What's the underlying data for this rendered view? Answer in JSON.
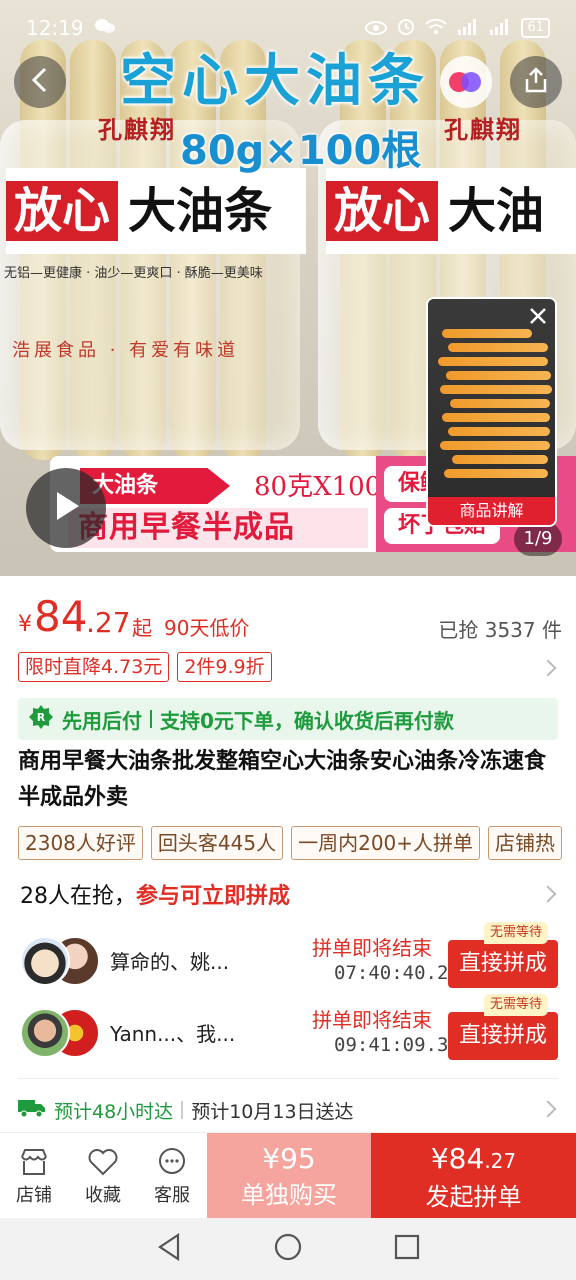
{
  "status_bar": {
    "time": "12:19",
    "battery": "61"
  },
  "hero": {
    "title": "空心大油条",
    "spec": "80g×100根",
    "bag_brand": "孔麒翔",
    "bag_band_red": "放心",
    "bag_band_black": "大油条",
    "bag_band_red_2": "放心",
    "bag_band_black_2": "大油",
    "bag_sub": "无铝—更健康 · 油少—更爽口 · 酥脆—更美味",
    "bag_script": "浩展食品 · 有爱有味道",
    "promo_tag": "大油条",
    "promo_spec": "80克X100个",
    "promo_main": "商用早餐半成品",
    "promo_chip_1": "保鲜",
    "promo_chip_2": "坏了包赔",
    "thumb_label": "商品讲解",
    "counter": "1/9"
  },
  "price": {
    "currency": "¥",
    "integer": "84",
    "decimal": ".27",
    "from": "起",
    "low_price": "90天低价",
    "sold": "已抢 3537 件"
  },
  "tags": [
    "限时直降4.73元",
    "2件9.9折"
  ],
  "pay_banner": {
    "part1": "先用后付",
    "part2": "支持0元下单，确认收货后再付款"
  },
  "product_title": "商用早餐大油条批发整箱空心大油条安心油条冷冻速食半成品外卖",
  "badges": [
    "2308人好评",
    "回头客445人",
    "一周内200+人拼单",
    "店铺热"
  ],
  "grab": {
    "count_text": "28人在抢，",
    "highlight": "参与可立即拼成"
  },
  "groups": [
    {
      "name": "算命的、姚...",
      "ends": "拼单即将结束",
      "timer": "07:40:40.2",
      "button": "直接拼成",
      "nowait": "无需等待"
    },
    {
      "name": "Yann...、我...",
      "ends": "拼单即将结束",
      "timer": "09:41:09.3",
      "button": "直接拼成",
      "nowait": "无需等待"
    }
  ],
  "shipping": {
    "estimate": "预计48小时达",
    "delivery": "预计10月13日送达"
  },
  "bottom_bar": {
    "store": "店铺",
    "favorite": "收藏",
    "service": "客服",
    "single_price": "¥95",
    "single_label": "单独购买",
    "group_price_int": "¥84",
    "group_price_dec": ".27",
    "group_label": "发起拼单"
  },
  "colors": {
    "accent": "#e02e24",
    "green": "#1e9b3c",
    "single_buy": "#f5a49e",
    "title_blue": "#1aa1d6"
  }
}
